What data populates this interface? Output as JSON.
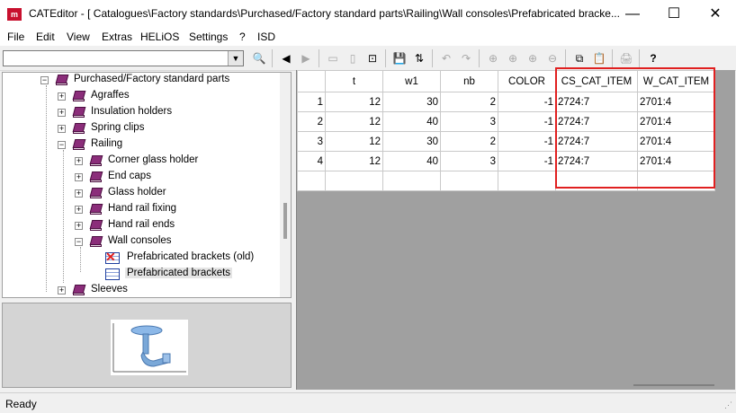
{
  "window": {
    "title": "CATEditor - [ Catalogues\\Factory standards\\Purchased/Factory standard parts\\Railing\\Wall consoles\\Prefabricated bracke...",
    "app_icon_text": "m",
    "minimize": "—",
    "maximize": "☐",
    "close": "✕"
  },
  "menu": [
    "File",
    "Edit",
    "View",
    "Extras",
    "HELiOS",
    "Settings",
    "?",
    "ISD"
  ],
  "toolbar": {
    "combo_value": "",
    "combo_arrow": "▼",
    "find": "🔍",
    "back": "◀",
    "forward": "▶",
    "save": "💾",
    "sort": "⇅",
    "undo": "↶",
    "redo": "↷",
    "copy": "⧉",
    "paste": "📋",
    "print": "🖨",
    "help": "?"
  },
  "tree": {
    "items": [
      {
        "label": "Purchased/Factory standard parts",
        "exp": "−"
      },
      {
        "label": "Agraffes",
        "exp": "+"
      },
      {
        "label": "Insulation holders",
        "exp": "+"
      },
      {
        "label": "Spring clips",
        "exp": "+"
      },
      {
        "label": "Railing",
        "exp": "−"
      },
      {
        "label": "Corner glass holder",
        "exp": "+"
      },
      {
        "label": "End caps",
        "exp": "+"
      },
      {
        "label": "Glass holder",
        "exp": "+"
      },
      {
        "label": "Hand rail fixing",
        "exp": "+"
      },
      {
        "label": "Hand rail ends",
        "exp": "+"
      },
      {
        "label": "Wall consoles",
        "exp": "−"
      },
      {
        "label": "Prefabricated brackets (old)",
        "exp": ""
      },
      {
        "label": "Prefabricated brackets",
        "exp": ""
      },
      {
        "label": "Sleeves",
        "exp": "+"
      }
    ]
  },
  "table": {
    "columns": [
      "",
      "t",
      "w1",
      "nb",
      "COLOR",
      "CS_CAT_ITEM",
      "W_CAT_ITEM"
    ],
    "rows": [
      [
        "1",
        "12",
        "30",
        "2",
        "-1",
        "2724:7",
        "2701:4"
      ],
      [
        "2",
        "12",
        "40",
        "3",
        "-1",
        "2724:7",
        "2701:4"
      ],
      [
        "3",
        "12",
        "30",
        "2",
        "-1",
        "2724:7",
        "2701:4"
      ],
      [
        "4",
        "12",
        "40",
        "3",
        "-1",
        "2724:7",
        "2701:4"
      ],
      [
        "",
        "",
        "",
        "",
        "",
        "",
        ""
      ]
    ]
  },
  "status": {
    "text": "Ready"
  }
}
